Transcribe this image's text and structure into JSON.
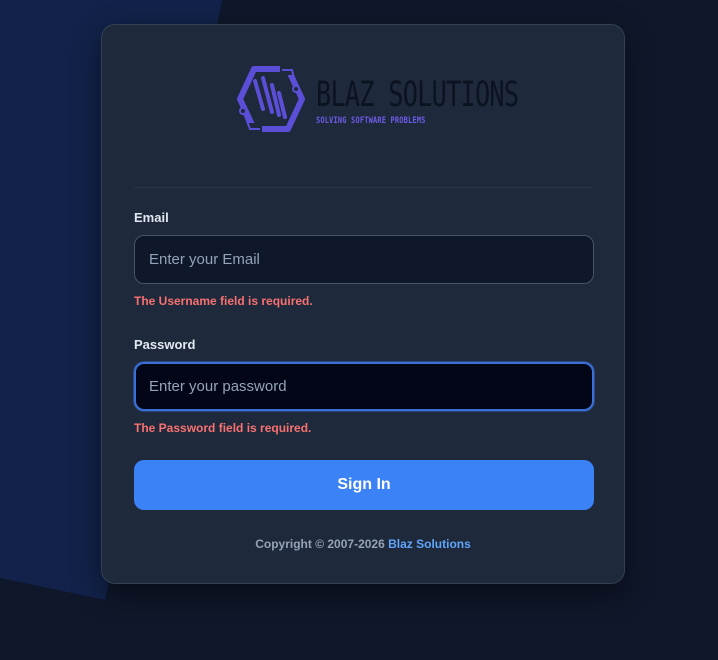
{
  "brand": {
    "name": "BLAZ SOLUTIONS",
    "tagline": "SOLVING SOFTWARE PROBLEMS",
    "logo_icon": "hexagon-bars-logo-icon",
    "accent_color": "#5b4fd8"
  },
  "form": {
    "email": {
      "label": "Email",
      "placeholder": "Enter your Email",
      "value": "",
      "error": "The Username field is required."
    },
    "password": {
      "label": "Password",
      "placeholder": "Enter your password",
      "value": "",
      "error": "The Password field is required."
    },
    "submit_label": "Sign In"
  },
  "footer": {
    "copyright": "Copyright © 2007-2026",
    "link_text": "Blaz Solutions"
  },
  "colors": {
    "background": "#0f172a",
    "card": "#1e293b",
    "primary": "#3b82f6",
    "error": "#f87171",
    "link": "#60a5fa"
  }
}
